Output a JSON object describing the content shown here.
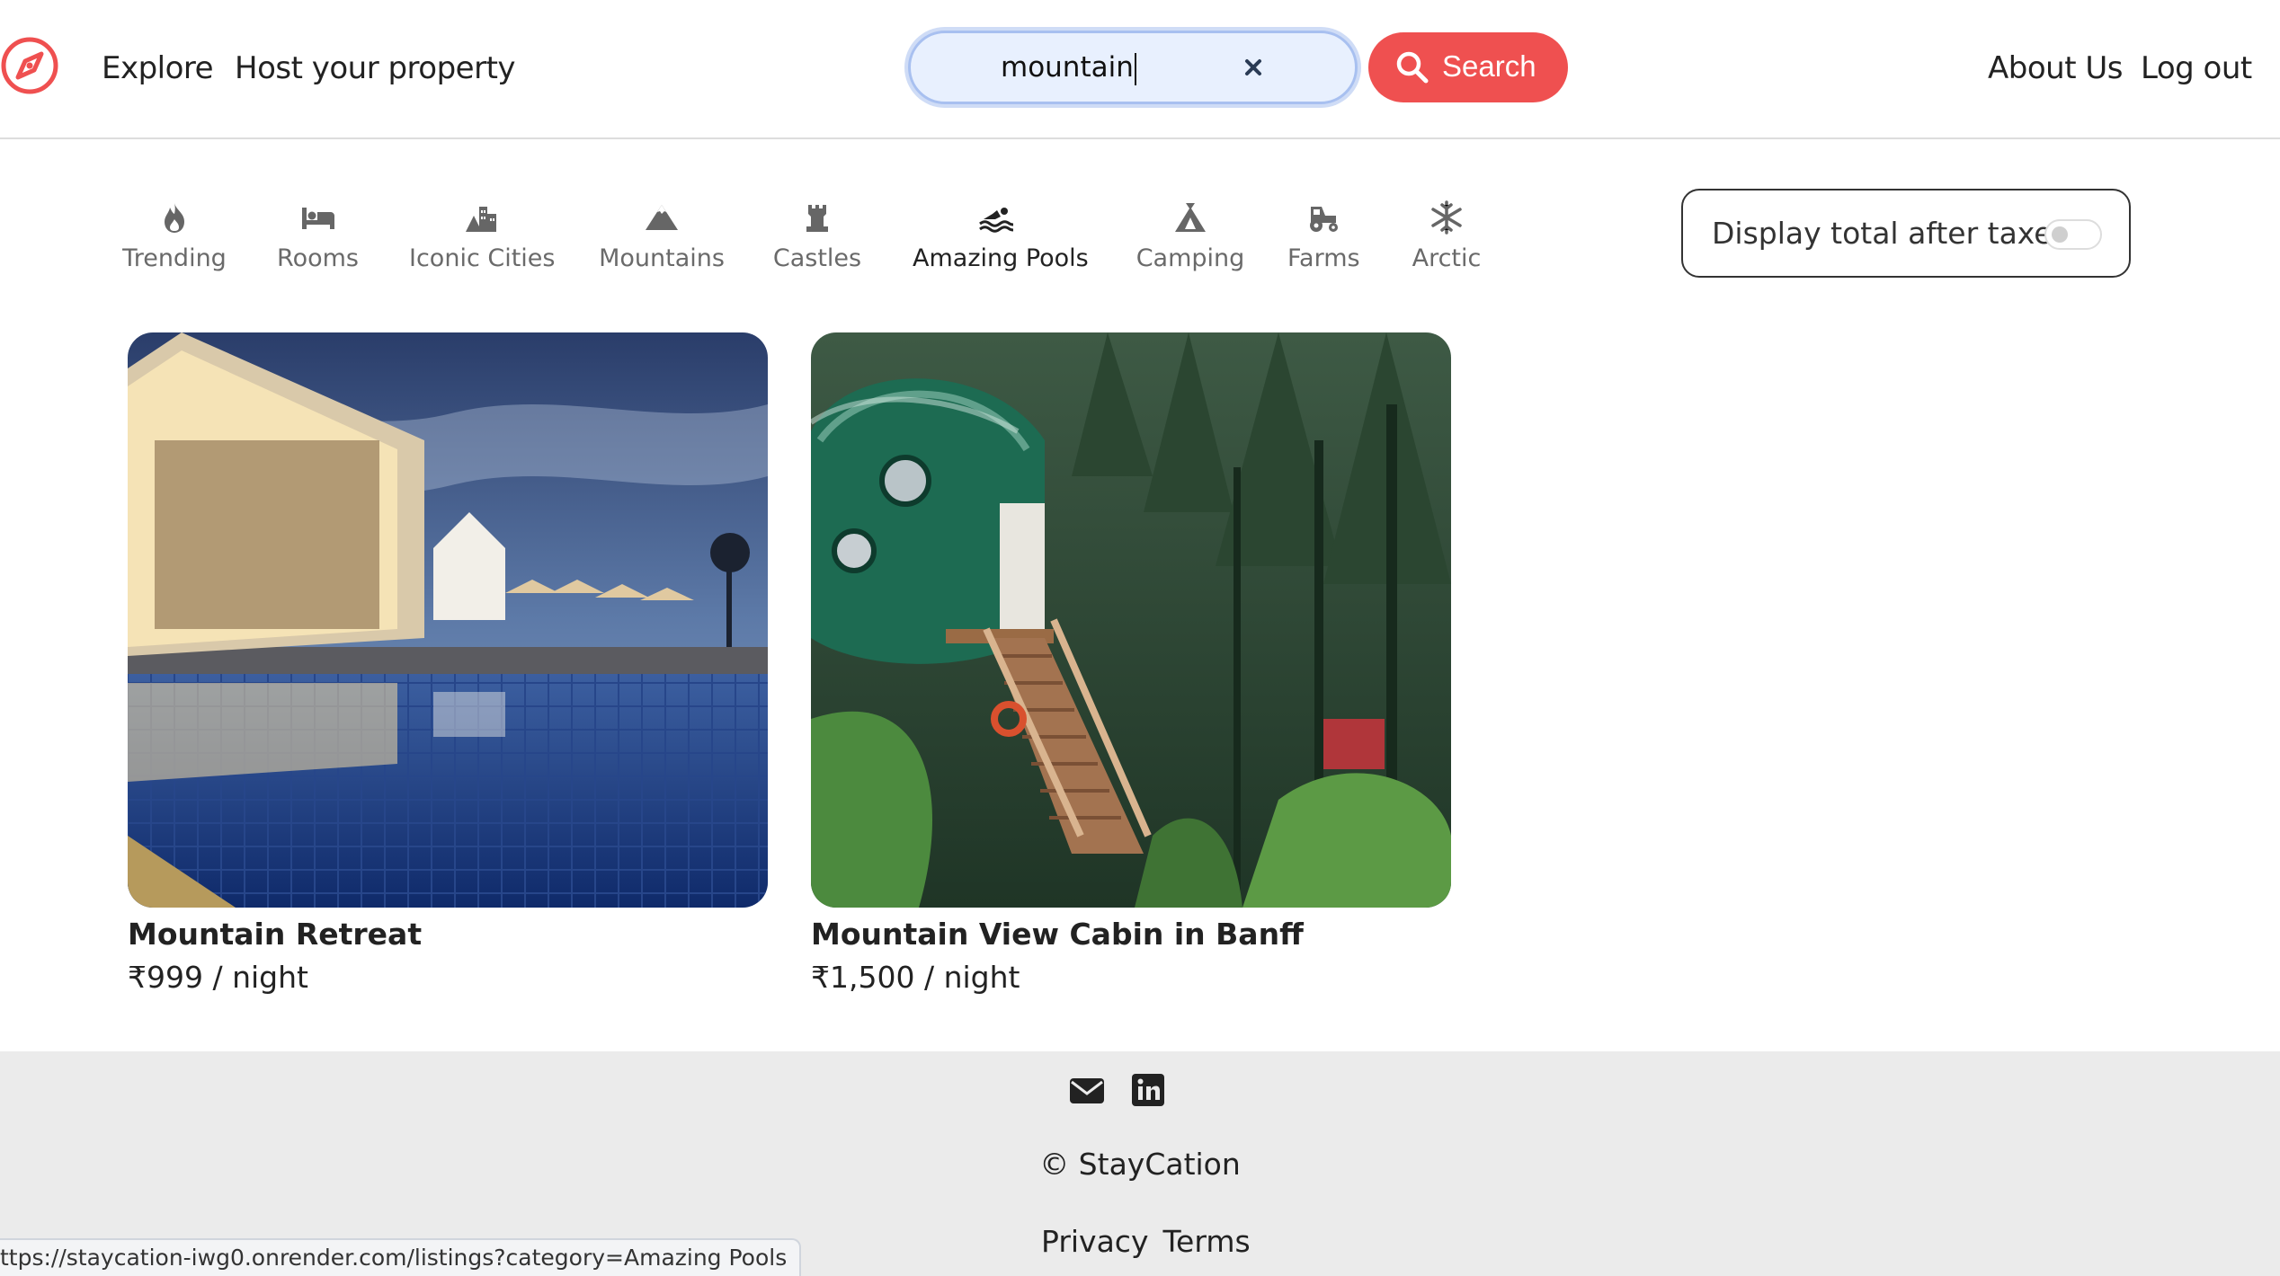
{
  "navbar": {
    "links_left": [
      "Explore",
      "Host your property"
    ],
    "search": {
      "value": "mountain",
      "placeholder": ""
    },
    "search_button_label": "Search",
    "links_right": [
      "About Us",
      "Log out"
    ]
  },
  "categories": [
    {
      "label": "Trending",
      "icon": "fire-icon"
    },
    {
      "label": "Rooms",
      "icon": "bed-icon"
    },
    {
      "label": "Iconic Cities",
      "icon": "city-icon"
    },
    {
      "label": "Mountains",
      "icon": "mountain-icon"
    },
    {
      "label": "Castles",
      "icon": "castle-icon"
    },
    {
      "label": "Amazing Pools",
      "icon": "swimmer-icon"
    },
    {
      "label": "Camping",
      "icon": "tent-icon"
    },
    {
      "label": "Farms",
      "icon": "tractor-icon"
    },
    {
      "label": "Arctic",
      "icon": "snowflake-icon"
    }
  ],
  "active_category": "Amazing Pools",
  "tax_toggle": {
    "label": "Display total after taxes",
    "on": false
  },
  "listings": [
    {
      "title": "Mountain Retreat",
      "price": "₹999 / night"
    },
    {
      "title": "Mountain View Cabin in Banff",
      "price": "₹1,500 / night"
    }
  ],
  "footer": {
    "icons": [
      "envelope-icon",
      "linkedin-icon"
    ],
    "copyright": "© StayCation",
    "links": [
      "Privacy",
      "Terms"
    ]
  },
  "status_bar_url": "ttps://staycation-iwg0.onrender.com/listings?category=Amazing Pools",
  "colors": {
    "brand": "#ef5050",
    "footer_bg": "#ebebeb",
    "search_bg": "#e8f0fe"
  }
}
